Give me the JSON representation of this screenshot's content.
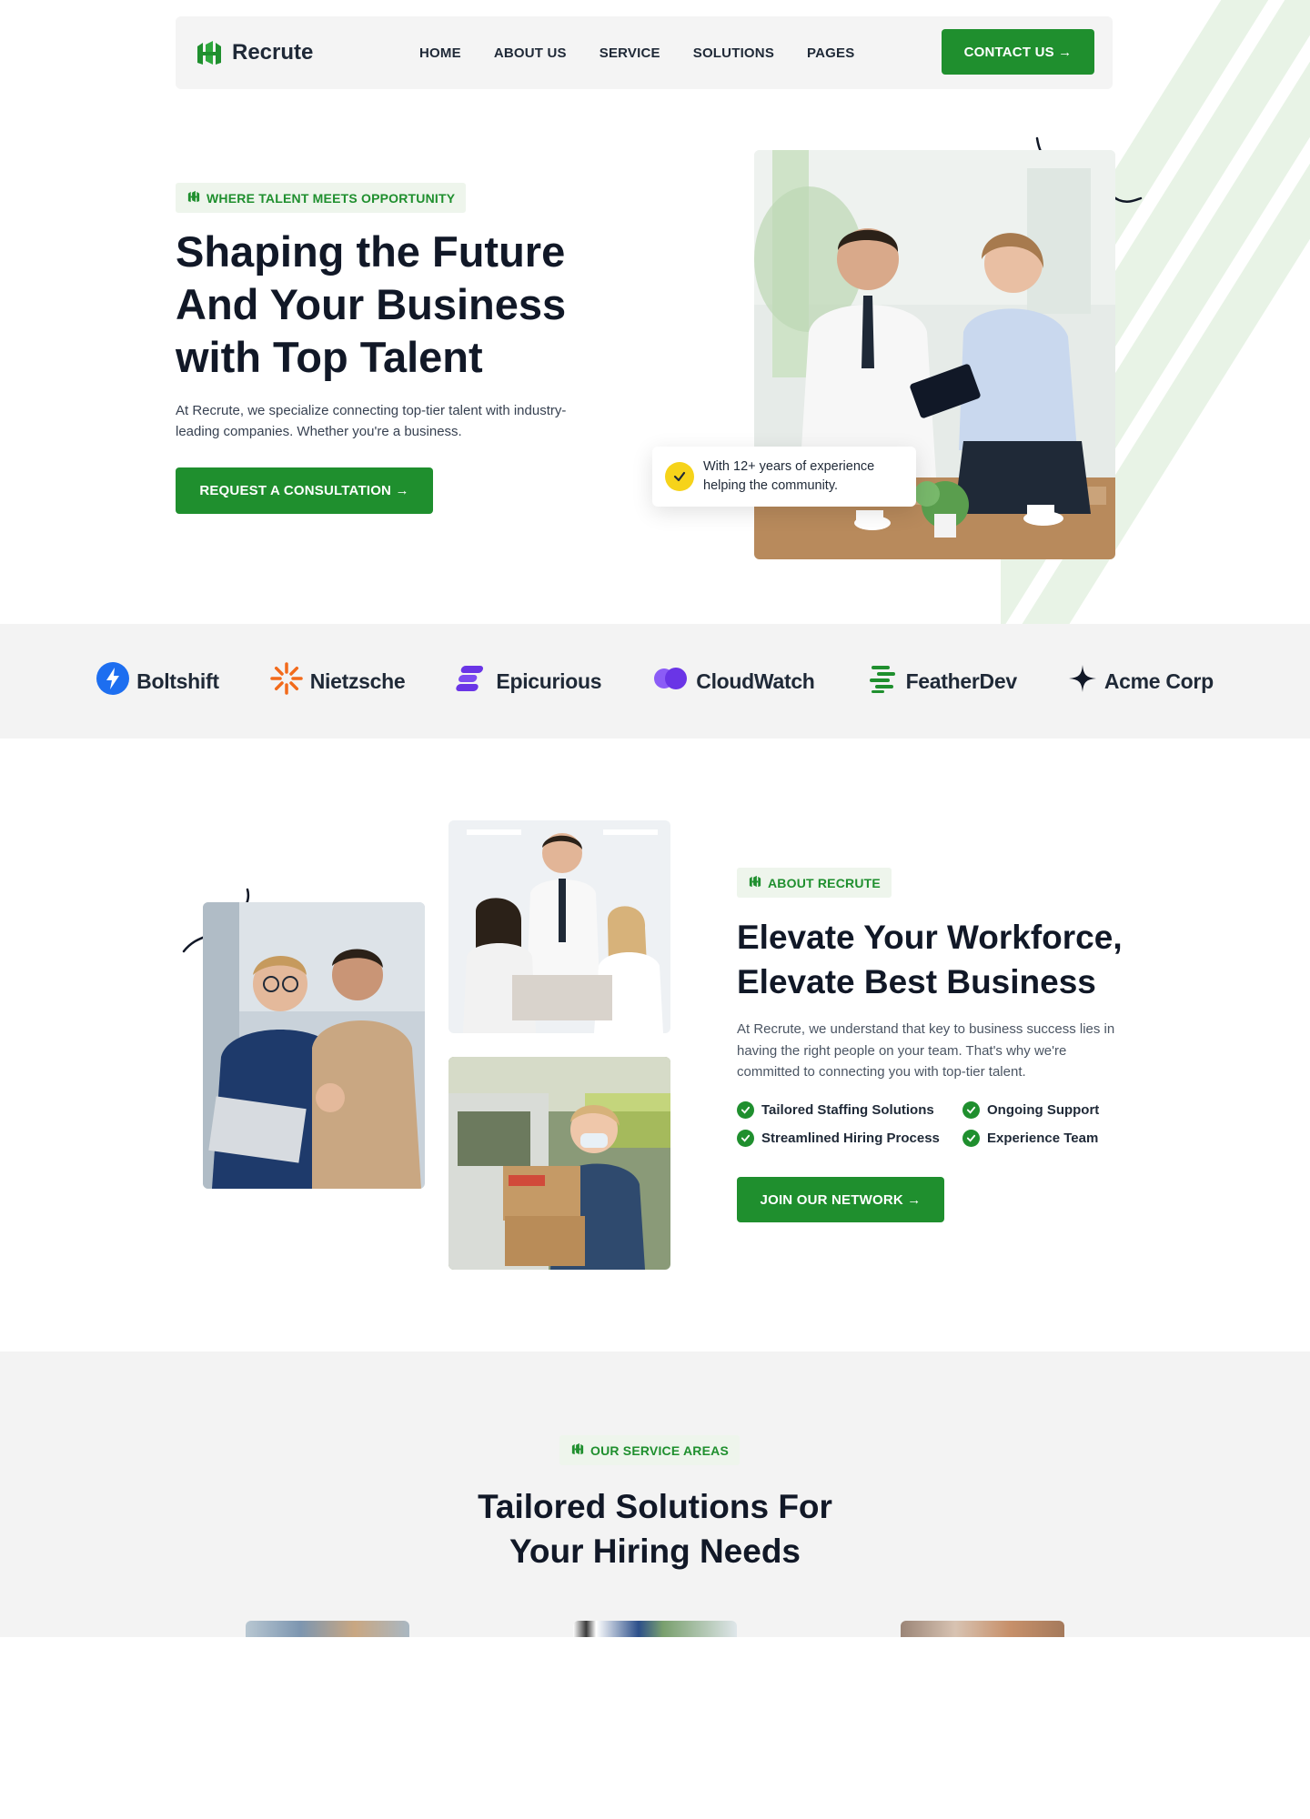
{
  "brand": {
    "name": "Recrute",
    "green": "#1f8f2e",
    "accent_yellow": "#f6d31a"
  },
  "nav": {
    "items": [
      "HOME",
      "ABOUT US",
      "SERVICE",
      "SOLUTIONS",
      "PAGES"
    ],
    "cta": "CONTACT US →"
  },
  "hero": {
    "tag": "WHERE TALENT MEETS OPPORTUNITY",
    "title_lines": [
      "Shaping the Future",
      "And Your Business",
      "with Top Talent"
    ],
    "text": "At Recrute, we specialize connecting top-tier talent with industry-leading companies. Whether you're a business.",
    "cta": "REQUEST A CONSULTATION →",
    "badge_text_lines": [
      "With 12+ years of experience",
      "helping the community."
    ],
    "image_icon": "business-meeting-photo"
  },
  "partners": [
    {
      "name": "Boltshift",
      "icon": "bolt-icon",
      "color": "#1d6ef0"
    },
    {
      "name": "Nietzsche",
      "icon": "sunburst-icon",
      "color": "#f26a1b"
    },
    {
      "name": "Epicurious",
      "icon": "stacked-bars-icon",
      "color": "#6a35e6"
    },
    {
      "name": "CloudWatch",
      "icon": "cloud-dots-icon",
      "color": "#6a35e6"
    },
    {
      "name": "FeatherDev",
      "icon": "feather-lines-icon",
      "color": "#1f8f2e"
    },
    {
      "name": "Acme Corp",
      "icon": "sparkle-icon",
      "color": "#111827"
    }
  ],
  "about": {
    "tag": "ABOUT RECRUTE",
    "title_lines": [
      "Elevate Your Workforce,",
      "Elevate Best Business"
    ],
    "text": "At Recrute, we understand that key to business success lies in having the right people on your team. That's why we're committed to connecting you with top-tier talent.",
    "features": [
      "Tailored Staffing Solutions",
      "Ongoing Support",
      "Streamlined Hiring Process",
      "Experience Team"
    ],
    "cta": "JOIN OUR NETWORK →"
  },
  "services": {
    "tag": "OUR SERVICE AREAS",
    "title_lines": [
      "Tailored Solutions For",
      "Your Hiring Needs"
    ]
  }
}
